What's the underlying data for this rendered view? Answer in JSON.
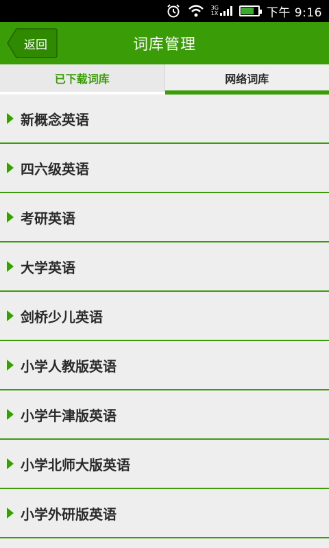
{
  "status_bar": {
    "network_top": "3G",
    "network_bottom": "1X",
    "time": "下午 9:16"
  },
  "header": {
    "back_label": "返回",
    "title": "词库管理"
  },
  "tabs": [
    {
      "label": "已下载词库",
      "active": false
    },
    {
      "label": "网络词库",
      "active": true
    }
  ],
  "list": [
    {
      "label": "新概念英语"
    },
    {
      "label": "四六级英语"
    },
    {
      "label": "考研英语"
    },
    {
      "label": "大学英语"
    },
    {
      "label": "剑桥少儿英语"
    },
    {
      "label": "小学人教版英语"
    },
    {
      "label": "小学牛津版英语"
    },
    {
      "label": "小学北师大版英语"
    },
    {
      "label": "小学外研版英语"
    }
  ],
  "colors": {
    "brand_green": "#3a9c06",
    "background": "#eeeeee",
    "text": "#2a2a2a"
  }
}
